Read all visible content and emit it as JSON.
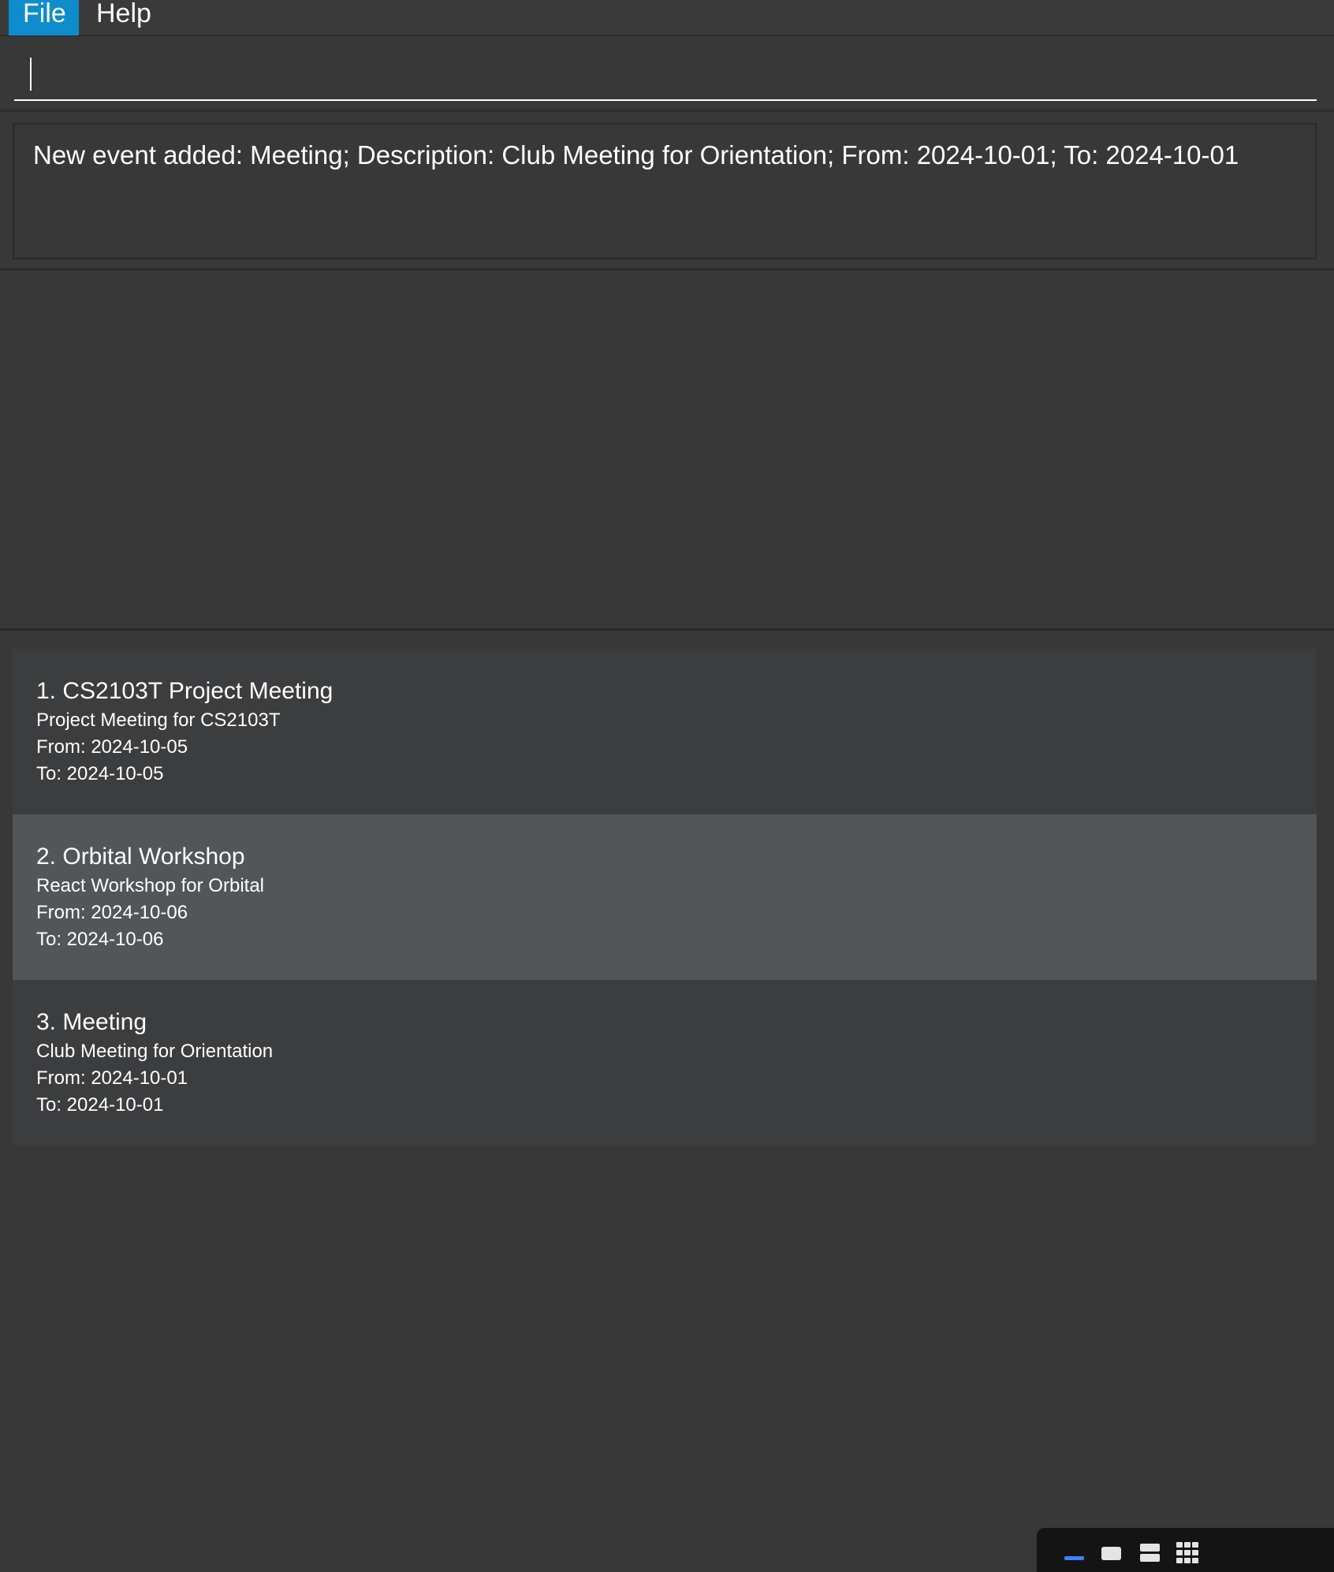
{
  "menu": {
    "file": "File",
    "help": "Help"
  },
  "command": {
    "value": "",
    "placeholder": ""
  },
  "result": {
    "message": "New event added: Meeting; Description: Club Meeting for Orientation; From: 2024-10-01; To: 2024-10-01"
  },
  "events": [
    {
      "title": "1. CS2103T Project Meeting",
      "description": "Project Meeting for CS2103T",
      "from": "From: 2024-10-05",
      "to": "To: 2024-10-05",
      "selected": false
    },
    {
      "title": "2. Orbital Workshop",
      "description": "React Workshop for Orbital",
      "from": "From: 2024-10-06",
      "to": "To: 2024-10-06",
      "selected": true
    },
    {
      "title": "3. Meeting",
      "description": "Club Meeting for Orientation",
      "from": "From: 2024-10-01",
      "to": "To: 2024-10-01",
      "selected": false
    }
  ],
  "dock": {
    "icons": [
      "minimize-icon",
      "single-window-icon",
      "split-window-icon",
      "grid-icon"
    ]
  },
  "colors": {
    "background": "#383838",
    "menu_active": "#0e8ccc",
    "card": "#3c3d3f",
    "card_selected": "#525659",
    "dock_accent": "#3b82f6"
  }
}
